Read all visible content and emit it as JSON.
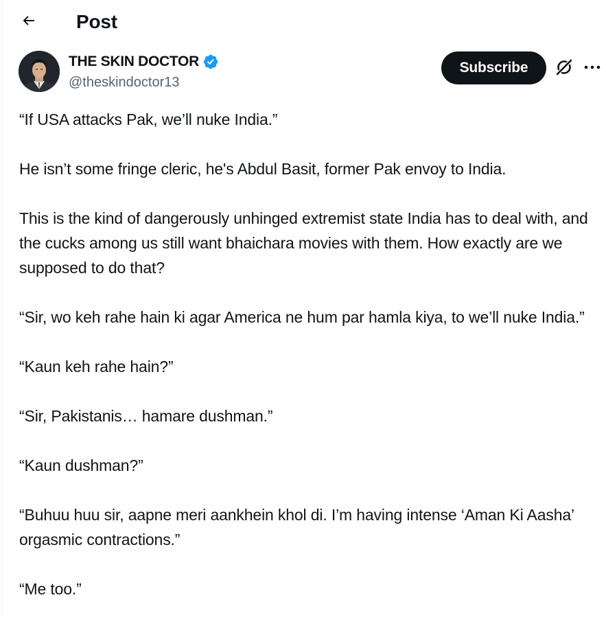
{
  "header": {
    "title": "Post",
    "back_icon": "arrow-left-icon"
  },
  "author": {
    "name": "THE SKIN DOCTOR",
    "handle": "@theskindoctor13",
    "verified_color": "#1d9bf0"
  },
  "actions": {
    "subscribe_label": "Subscribe",
    "grok_icon": "grok-icon",
    "more_icon": "more-dots-icon"
  },
  "post": {
    "paragraphs": [
      "“If USA attacks Pak, we’ll nuke India.”",
      "He isn’t some fringe cleric, he's Abdul Basit, former Pak envoy to India.",
      "This is the kind of dangerously unhinged extremist state India has to deal with, and the cucks among us still want bhaichara movies with them. How exactly are we supposed to do that?",
      "“Sir, wo keh rahe hain ki agar America ne hum par hamla kiya, to we’ll nuke India.”",
      "“Kaun keh rahe hain?”",
      "“Sir, Pakistanis… hamare dushman.”",
      "“Kaun dushman?”",
      "“Buhuu huu sir, aapne meri aankhein khol di. I’m having intense ‘Aman Ki Aasha’ orgasmic contractions.”",
      "“Me too.”"
    ]
  },
  "colors": {
    "text": "#0f1419",
    "secondary": "#536471",
    "button_bg": "#0f1419",
    "button_text": "#ffffff"
  }
}
